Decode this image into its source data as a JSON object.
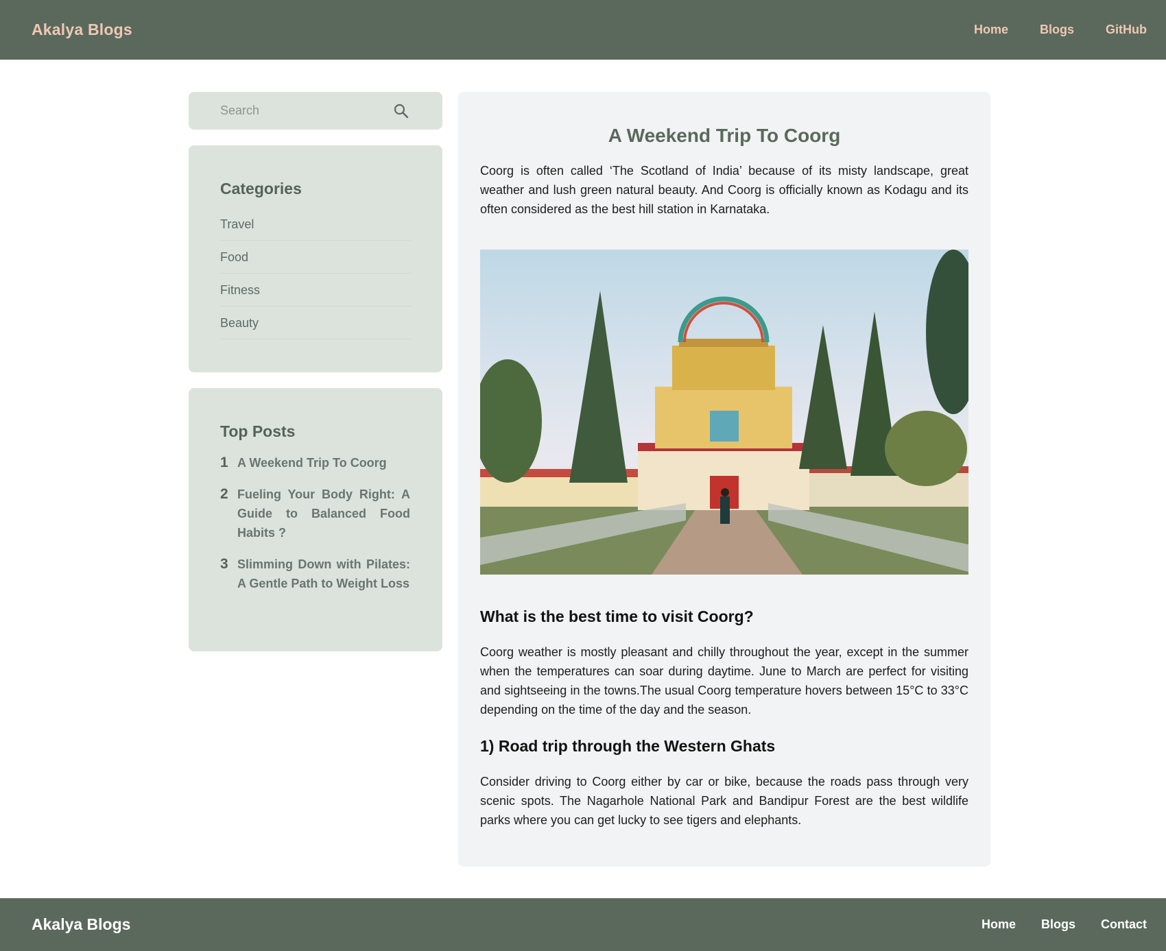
{
  "header": {
    "brand": "Akalya Blogs",
    "nav": [
      "Home",
      "Blogs",
      "GitHub"
    ]
  },
  "search": {
    "placeholder": "Search",
    "icon": "search-icon"
  },
  "categories": {
    "title": "Categories",
    "items": [
      "Travel",
      "Food",
      "Fitness",
      "Beauty"
    ]
  },
  "top_posts": {
    "title": "Top Posts",
    "items": [
      {
        "num": "1",
        "title": "A Weekend Trip To Coorg"
      },
      {
        "num": "2",
        "title": "Fueling Your Body Right: A Guide to Balanced Food Habits ?"
      },
      {
        "num": "3",
        "title": "Slimming Down with Pilates: A Gentle Path to Weight Loss"
      }
    ]
  },
  "article": {
    "title": "A Weekend Trip To Coorg",
    "intro": "Coorg is often called ‘The Scotland of India’ because of its misty landscape, great weather and lush green natural beauty. And Coorg is officially known as Kodagu and its often considered as the best hill station in Karnataka.",
    "section1_heading": "What is the best time to visit Coorg?",
    "section1_text": "Coorg weather is mostly pleasant and chilly throughout the year, except in the summer when the temperatures can soar during daytime. June to March are perfect for visiting and sightseeing in the towns.The usual Coorg temperature hovers between 15°C to 33°C depending on the time of the day and the season.",
    "section2_heading": "1) Road trip through the Western Ghats",
    "section2_text": "Consider driving to Coorg either by car or bike, because the roads pass through very scenic spots. The Nagarhole National Park and Bandipur Forest are the best wildlife parks where you can get lucky to see tigers and elephants."
  },
  "footer": {
    "brand": "Akalya Blogs",
    "nav": [
      "Home",
      "Blogs",
      "Contact"
    ]
  },
  "colors": {
    "header_bg": "#5a695c",
    "brand_accent": "#efc8b3",
    "sidebar_card": "#dce3dc",
    "article_bg": "#f2f3f4"
  }
}
